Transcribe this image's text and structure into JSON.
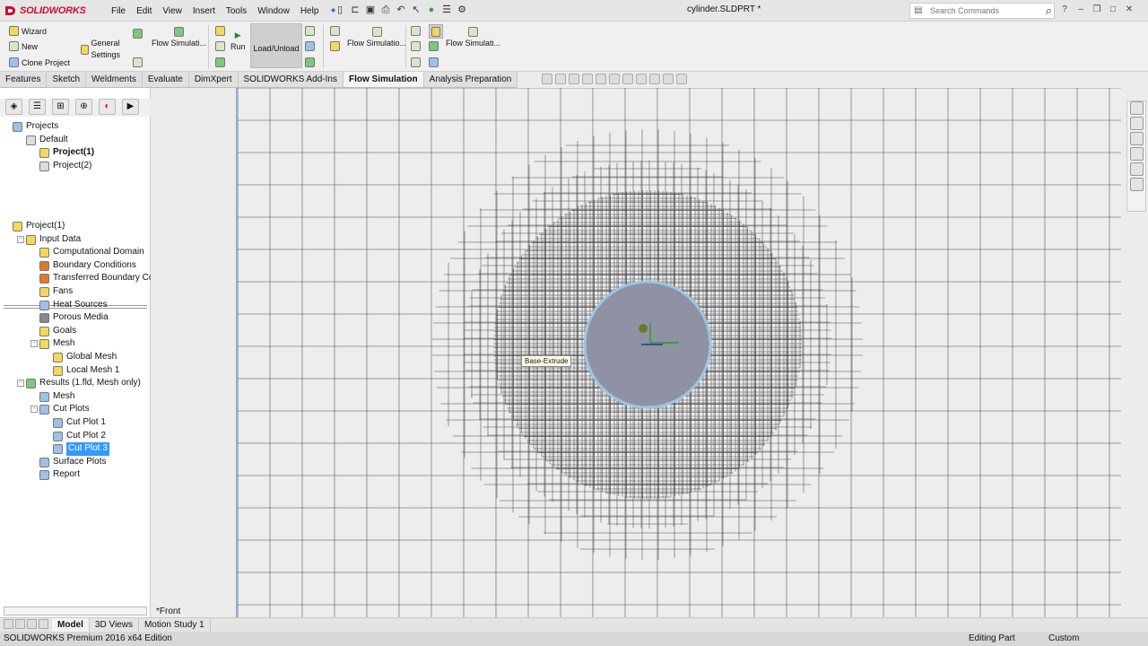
{
  "app": {
    "logo_text": "SOLIDWORKS",
    "document_title": "cylinder.SLDPRT *"
  },
  "menu": [
    "File",
    "Edit",
    "View",
    "Insert",
    "Tools",
    "Window",
    "Help"
  ],
  "search": {
    "placeholder": "Search Commands"
  },
  "ribbon": {
    "wizard": "Wizard",
    "new": "New",
    "clone": "Clone Project",
    "general_settings": "General Settings",
    "flow_sim_1": "Flow Simulati...",
    "run": "Run",
    "load_unload": "Load/Unload",
    "flow_sim_2": "Flow Simulatio...",
    "flow_sim_3": "Flow Simulati..."
  },
  "command_tabs": [
    {
      "label": "Features",
      "active": false
    },
    {
      "label": "Sketch",
      "active": false
    },
    {
      "label": "Weldments",
      "active": false
    },
    {
      "label": "Evaluate",
      "active": false
    },
    {
      "label": "DimXpert",
      "active": false
    },
    {
      "label": "SOLIDWORKS Add-Ins",
      "active": false
    },
    {
      "label": "Flow Simulation",
      "active": true
    },
    {
      "label": "Analysis Preparation",
      "active": false
    }
  ],
  "projects_tree": [
    {
      "label": "Projects",
      "level": 0,
      "icon": "projects-icon",
      "color": "#9ec1e8"
    },
    {
      "label": "Default",
      "level": 1,
      "icon": "config-icon",
      "color": "#dddddd"
    },
    {
      "label": "Project(1)",
      "level": 2,
      "icon": "project-icon",
      "color": "#f2d95a",
      "bold": true
    },
    {
      "label": "Project(2)",
      "level": 2,
      "icon": "project-icon",
      "color": "#dddddd"
    }
  ],
  "analysis_tree": [
    {
      "label": "Project(1)",
      "level": 0,
      "icon": "project-icon",
      "color": "#f2d95a"
    },
    {
      "label": "Input Data",
      "level": 1,
      "icon": "input-data-icon",
      "color": "#f2d95a",
      "toggle": "-"
    },
    {
      "label": "Computational Domain",
      "level": 2,
      "icon": "domain-icon",
      "color": "#f2d95a"
    },
    {
      "label": "Boundary Conditions",
      "level": 2,
      "icon": "boundary-icon",
      "color": "#e07a2a"
    },
    {
      "label": "Transferred Boundary Con",
      "level": 2,
      "icon": "transfer-icon",
      "color": "#e07a2a"
    },
    {
      "label": "Fans",
      "level": 2,
      "icon": "fan-icon",
      "color": "#f2d95a"
    },
    {
      "label": "Heat Sources",
      "level": 2,
      "icon": "heat-icon",
      "color": "#9ec1e8"
    },
    {
      "label": "Porous Media",
      "level": 2,
      "icon": "porous-icon",
      "color": "#888888"
    },
    {
      "label": "Goals",
      "level": 2,
      "icon": "goals-icon",
      "color": "#f2d95a"
    },
    {
      "label": "Mesh",
      "level": 2,
      "icon": "mesh-icon",
      "color": "#f2d95a",
      "toggle": "-"
    },
    {
      "label": "Global Mesh",
      "level": 3,
      "icon": "mesh-icon",
      "color": "#f2d95a"
    },
    {
      "label": "Local Mesh 1",
      "level": 3,
      "icon": "local-mesh-icon",
      "color": "#f2d95a"
    },
    {
      "label": "Results (1.fld, Mesh only)",
      "level": 1,
      "icon": "results-icon",
      "color": "#7fc67f",
      "toggle": "-"
    },
    {
      "label": "Mesh",
      "level": 2,
      "icon": "mesh-icon",
      "color": "#9ec1e8"
    },
    {
      "label": "Cut Plots",
      "level": 2,
      "icon": "cut-plot-icon",
      "color": "#9ec1e8",
      "toggle": "-"
    },
    {
      "label": "Cut Plot 1",
      "level": 3,
      "icon": "cut-plot-icon",
      "color": "#9ec1e8"
    },
    {
      "label": "Cut Plot 2",
      "level": 3,
      "icon": "cut-plot-icon",
      "color": "#9ec1e8"
    },
    {
      "label": "Cut Plot 3",
      "level": 3,
      "icon": "cut-plot-icon",
      "color": "#9ec1e8",
      "selected": true
    },
    {
      "label": "Surface Plots",
      "level": 2,
      "icon": "surface-plot-icon",
      "color": "#9ec1e8"
    },
    {
      "label": "Report",
      "level": 2,
      "icon": "report-icon",
      "color": "#9ec1e8"
    }
  ],
  "viewport": {
    "view_name": "*Front",
    "tooltip": "Base-Extrude",
    "accent": "#8ab0d0",
    "body_color": "#8f92a3"
  },
  "bottom_tabs": [
    {
      "label": "Model",
      "active": true
    },
    {
      "label": "3D Views",
      "active": false
    },
    {
      "label": "Motion Study 1",
      "active": false
    }
  ],
  "status": {
    "edition": "SOLIDWORKS Premium 2016 x64 Edition",
    "mode": "Editing Part",
    "units": "Custom"
  }
}
